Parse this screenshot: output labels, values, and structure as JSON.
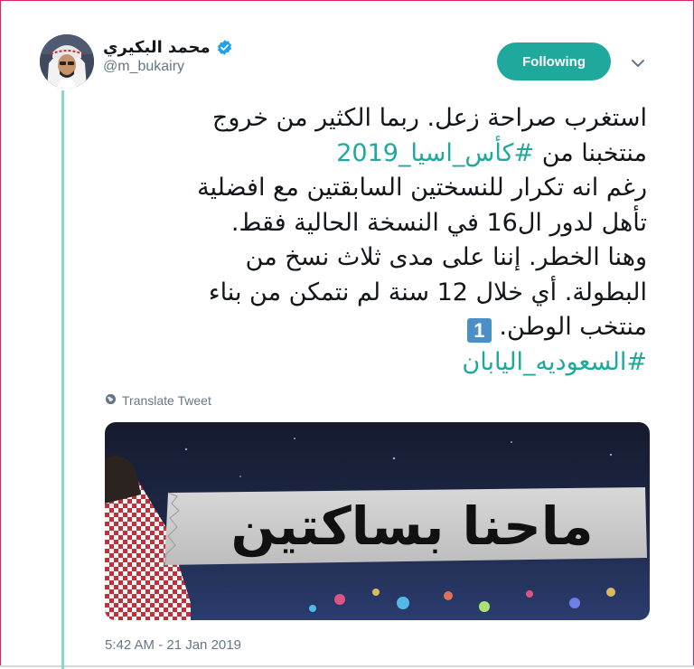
{
  "author": {
    "name": "محمد البكيري",
    "handle": "@m_bukairy",
    "verified": true
  },
  "follow_button": {
    "label": "Following"
  },
  "tweet": {
    "lines": [
      {
        "text": "استغرب صراحة زعل. ربما الكثير من خروج"
      },
      {
        "prefix": "منتخبنا من ",
        "hashtag": "#كأس_اسيا_2019"
      },
      {
        "text": "رغم انه تكرار للنسختين السابقتين مع افضلية"
      },
      {
        "text": "تأهل لدور ال16 في النسخة الحالية فقط."
      },
      {
        "text": "وهنا الخطر. إننا على مدى ثلاث نسخ من"
      },
      {
        "text": "البطولة. أي خلال 12 سنة لم نتمكن من بناء"
      },
      {
        "text": "منتخب الوطن.",
        "keycap": "1"
      },
      {
        "hashtag": "#السعوديه_اليابان"
      }
    ]
  },
  "translate": {
    "label": "Translate Tweet",
    "icon": "globe-icon"
  },
  "media": {
    "caption_text": "ماحنا بساكتين"
  },
  "timestamp": "5:42 AM - 21 Jan 2019",
  "colors": {
    "accent": "#1fa89c",
    "thread_line": "#8fd3cf",
    "verified": "#1da1f2",
    "secondary_text": "#657786",
    "keycap": "#4a8fc6"
  }
}
